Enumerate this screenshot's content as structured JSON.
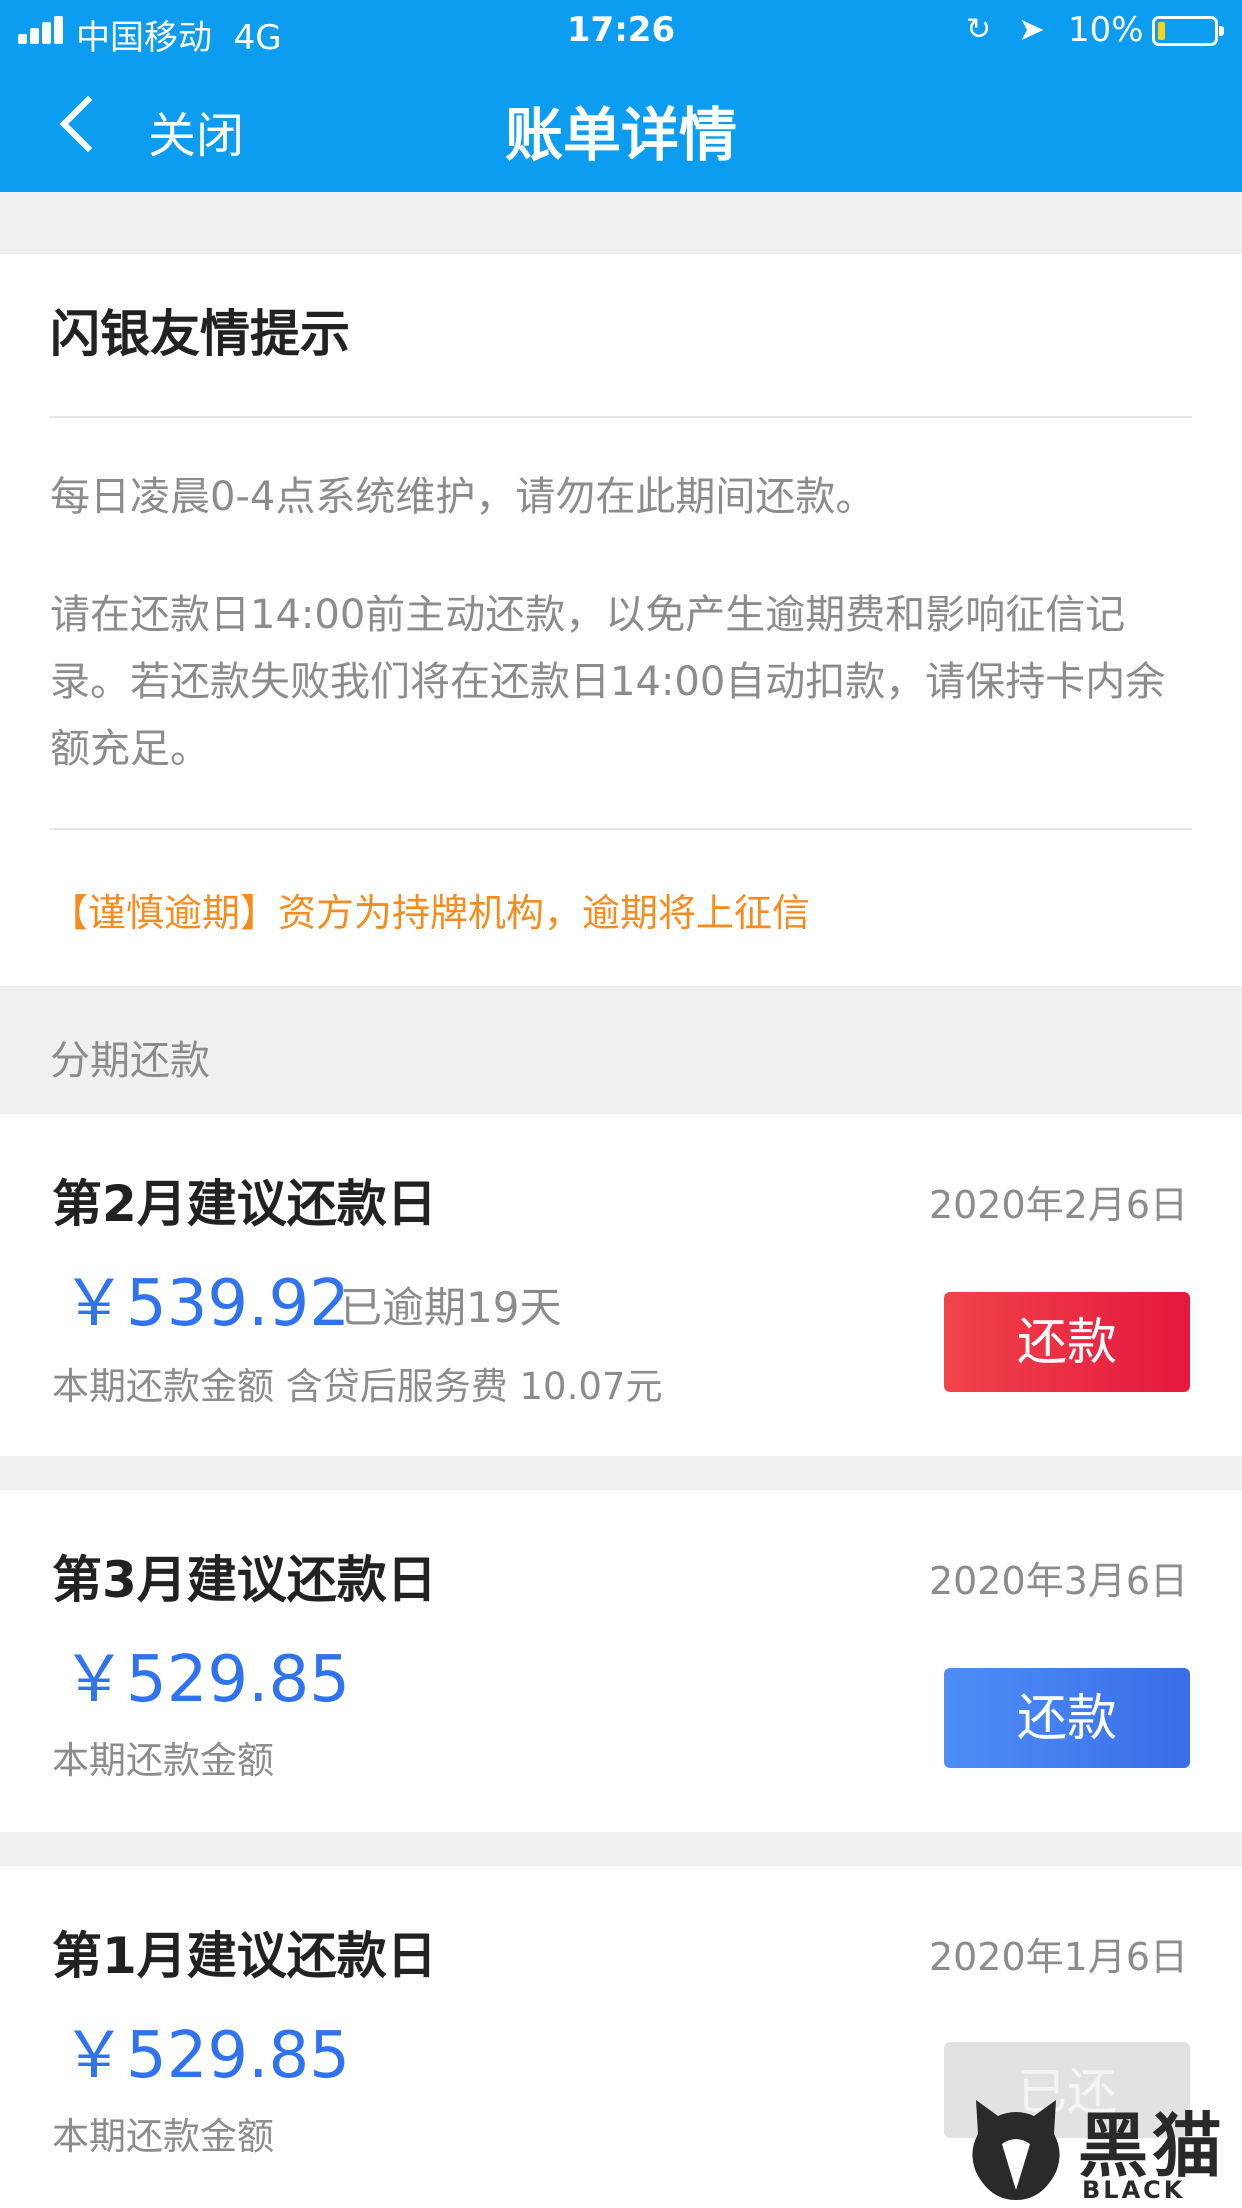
{
  "status_bar": {
    "carrier": "中国移动",
    "network": "4G",
    "time": "17:26",
    "battery_percent": "10%",
    "battery_level": 0.1,
    "colors": {
      "background": "#0c9cf0",
      "battery_fill": "#f7d21a"
    }
  },
  "nav": {
    "back_icon": "chevron-left-icon",
    "close_label": "关闭",
    "title": "账单详情"
  },
  "tips": {
    "title": "闪银友情提示",
    "line1": "每日凌晨0-4点系统维护，请勿在此期间还款。",
    "line2": "请在还款日14:00前主动还款，以免产生逾期费和影响征信记录。若还款失败我们将在还款日14:00自动扣款，请保持卡内余额充足。",
    "warning": "【谨慎逾期】资方为持牌机构，逾期将上征信",
    "warning_color": "#f78c1e"
  },
  "section": {
    "label": "分期还款"
  },
  "installments": [
    {
      "title": "第2月建议还款日",
      "date": "2020年2月6日",
      "amount": "￥539.92",
      "overdue": "已逾期19天",
      "subtitle": "本期还款金额 含贷后服务费 10.07元",
      "button_label": "还款",
      "button_color": "#e5183e"
    },
    {
      "title": "第3月建议还款日",
      "date": "2020年3月6日",
      "amount": "￥529.85",
      "subtitle": "本期还款金额",
      "button_label": "还款",
      "button_color": "#3a6de8"
    },
    {
      "title": "第1月建议还款日",
      "date": "2020年1月6日",
      "amount": "￥529.85",
      "subtitle": "本期还款金额",
      "button_label": "已还",
      "button_color": "#e2e2e2"
    }
  ],
  "watermark": {
    "cn": "黑猫",
    "en": "BLACK CAT"
  }
}
